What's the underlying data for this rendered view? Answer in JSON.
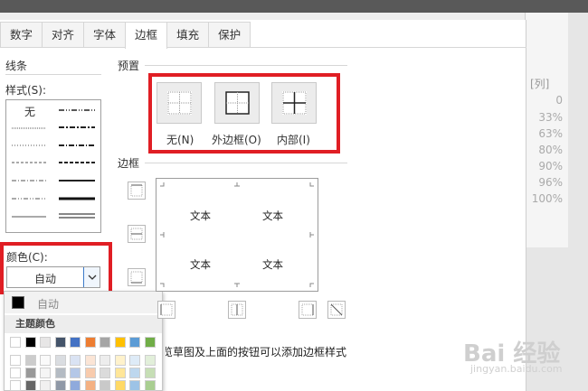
{
  "tabs": [
    {
      "label": "数字"
    },
    {
      "label": "对齐"
    },
    {
      "label": "字体"
    },
    {
      "label": "边框"
    },
    {
      "label": "填充"
    },
    {
      "label": "保护"
    }
  ],
  "line_section": {
    "title": "线条",
    "style_label": "样式(S):",
    "none_label": "无"
  },
  "preset_section": {
    "title": "预置",
    "buttons": [
      {
        "label": "无(N)"
      },
      {
        "label": "外边框(O)"
      },
      {
        "label": "内部(I)"
      }
    ]
  },
  "border_section": {
    "title": "边框",
    "preview_text": [
      "文本",
      "文本",
      "文本",
      "文本"
    ]
  },
  "color_section": {
    "label": "颜色(C):",
    "selected": "自动"
  },
  "color_popup": {
    "auto_label": "自动",
    "theme_header": "主题颜色",
    "theme_colors": [
      "#ffffff",
      "#000000",
      "#e7e6e6",
      "#44546a",
      "#4472c4",
      "#ed7d31",
      "#a5a5a5",
      "#ffc000",
      "#5b9bd5",
      "#70ad47"
    ]
  },
  "hint_text": "单击预置选项、预览草图及上面的按钮可以添加边框样式。",
  "sheet": {
    "header": "[列]",
    "values": [
      "0",
      "33%",
      "63%",
      "80%",
      "90%",
      "96%",
      "100%"
    ]
  },
  "watermark": {
    "title": "Bai 经验",
    "subtitle": "jingyan.baidu.com"
  },
  "colors": {
    "highlight": "#e01e24",
    "accent": "#3c7ac9"
  }
}
